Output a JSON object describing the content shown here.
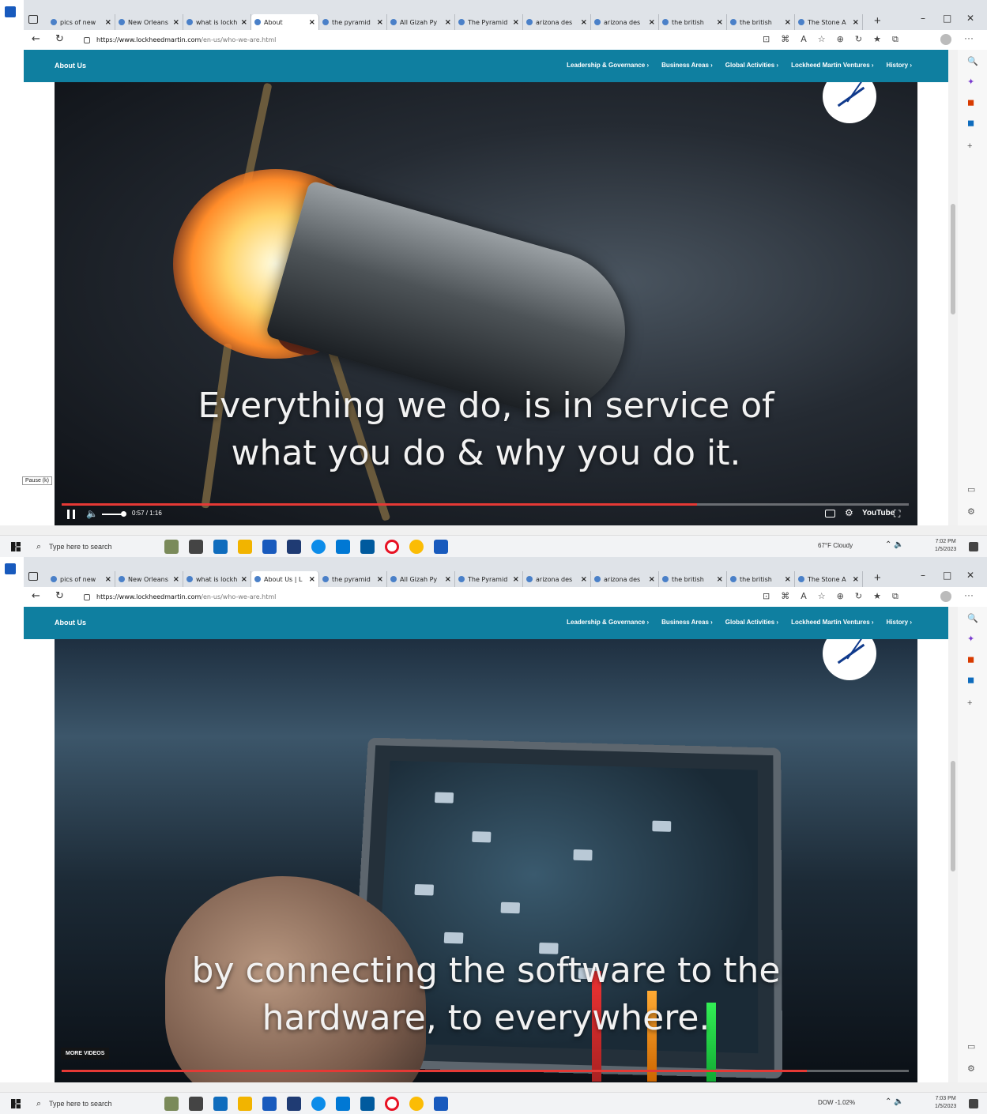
{
  "shots": [
    {
      "tabs": [
        {
          "label": "pics of new",
          "active": false
        },
        {
          "label": "New Orleans",
          "active": false
        },
        {
          "label": "what is lockh",
          "active": false
        },
        {
          "label": "About",
          "active": true
        },
        {
          "label": "the pyramid",
          "active": false
        },
        {
          "label": "All Gizah Py",
          "active": false
        },
        {
          "label": "The Pyramid",
          "active": false
        },
        {
          "label": "arizona des",
          "active": false
        },
        {
          "label": "arizona des",
          "active": false
        },
        {
          "label": "the british",
          "active": false
        },
        {
          "label": "the british",
          "active": false
        },
        {
          "label": "The Stone A",
          "active": false
        }
      ],
      "subtitle_line1": "Everything we do, is in service of",
      "subtitle_line2": "what you do & why you do it.",
      "time": "0:57 / 1:16",
      "progress": 0.75,
      "tooltip": "Pause (k)",
      "weather": "67°F Cloudy",
      "clock_time": "7:02 PM",
      "clock_date": "1/5/2023"
    },
    {
      "tabs": [
        {
          "label": "pics of new",
          "active": false
        },
        {
          "label": "New Orleans",
          "active": false
        },
        {
          "label": "what is lockh",
          "active": false
        },
        {
          "label": "About Us | L",
          "active": true
        },
        {
          "label": "the pyramid",
          "active": false
        },
        {
          "label": "All Gizah Py",
          "active": false
        },
        {
          "label": "The Pyramid",
          "active": false
        },
        {
          "label": "arizona des",
          "active": false
        },
        {
          "label": "arizona des",
          "active": false
        },
        {
          "label": "the british",
          "active": false
        },
        {
          "label": "the british",
          "active": false
        },
        {
          "label": "The Stone A",
          "active": false
        }
      ],
      "subtitle_line1": "by connecting the software to the",
      "subtitle_line2": "hardware, to everywhere.",
      "more_videos": "MORE VIDEOS",
      "progress": 0.88,
      "weather": "DOW -1.02%",
      "clock_time": "7:03 PM",
      "clock_date": "1/5/2023"
    }
  ],
  "browser": {
    "url_domain": "https://www.lockheedmartin.com",
    "url_path": "/en-us/who-we-are.html"
  },
  "site_nav": {
    "section_title": "About Us",
    "links": [
      "Leadership & Governance",
      "Business Areas",
      "Global Activities",
      "Lockheed Martin Ventures",
      "History"
    ]
  },
  "player": {
    "brand": "YouTube"
  },
  "taskbar": {
    "search_placeholder": "Type here to search"
  },
  "colors": {
    "nav_teal": "#0f7fa0",
    "progress_red": "#e53935"
  }
}
